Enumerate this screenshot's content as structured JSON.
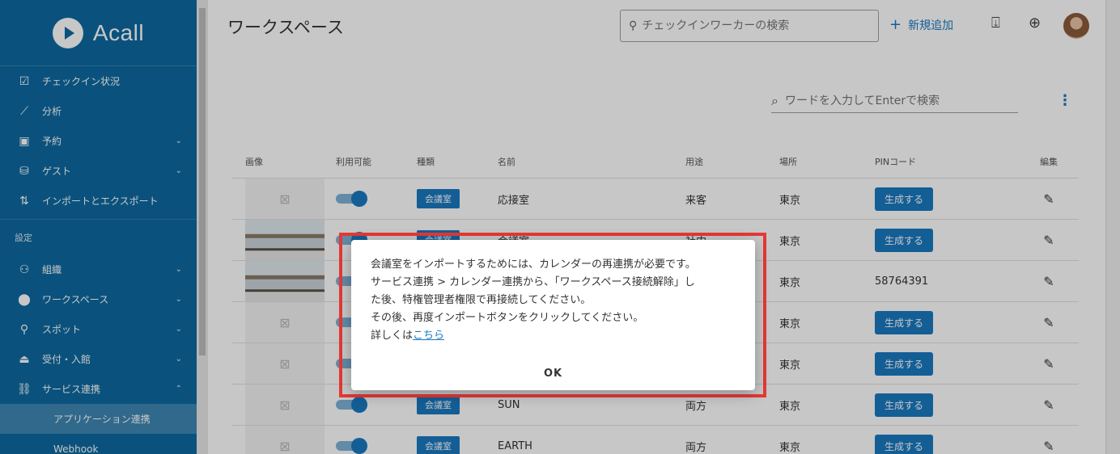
{
  "app": {
    "brand": "Acall"
  },
  "sidebar": {
    "items": [
      {
        "label": "チェックイン状況",
        "icon": "checkbox-icon",
        "glyph": "☑",
        "chevron": ""
      },
      {
        "label": "分析",
        "icon": "chart-icon",
        "glyph": "⟋",
        "chevron": ""
      },
      {
        "label": "予約",
        "icon": "calendar-icon",
        "glyph": "▣",
        "chevron": "⌄"
      },
      {
        "label": "ゲスト",
        "icon": "guest-icon",
        "glyph": "⛁",
        "chevron": "⌄"
      },
      {
        "label": "インポートとエクスポート",
        "icon": "import-export-icon",
        "glyph": "⇅",
        "chevron": ""
      }
    ],
    "section_label": "設定",
    "settings_items": [
      {
        "label": "組織",
        "icon": "people-icon",
        "glyph": "⚇",
        "chevron": "⌄"
      },
      {
        "label": "ワークスペース",
        "icon": "location-pin-icon",
        "glyph": "⬤",
        "chevron": "⌄"
      },
      {
        "label": "スポット",
        "icon": "spot-pin-icon",
        "glyph": "⚲",
        "chevron": "⌄"
      },
      {
        "label": "受付・入館",
        "icon": "reception-icon",
        "glyph": "⏏",
        "chevron": "⌄"
      },
      {
        "label": "サービス連携",
        "icon": "integration-icon",
        "glyph": "⛓",
        "chevron": "⌃"
      }
    ],
    "sub_items": [
      {
        "label": "アプリケーション連携",
        "active": true
      },
      {
        "label": "Webhook",
        "active": false
      }
    ]
  },
  "header": {
    "title": "ワークスペース",
    "search_placeholder": "チェックインワーカーの検索",
    "new_label": "新規追加"
  },
  "main": {
    "search_placeholder": "ワードを入力してEnterで検索"
  },
  "table": {
    "columns": [
      "画像",
      "利用可能",
      "種類",
      "名前",
      "用途",
      "場所",
      "PINコード",
      "編集"
    ],
    "rows": [
      {
        "image": "none",
        "type": "会議室",
        "name": "応接室",
        "use": "来客",
        "location": "東京",
        "pin": "生成する",
        "pin_is_button": true
      },
      {
        "image": "photo",
        "type": "会議室",
        "name": "会議室",
        "use": "社内",
        "location": "東京",
        "pin": "生成する",
        "pin_is_button": true
      },
      {
        "image": "photo",
        "type": "",
        "name": "",
        "use": "",
        "location": "東京",
        "pin": "58764391",
        "pin_is_button": false
      },
      {
        "image": "none",
        "type": "",
        "name": "",
        "use": "",
        "location": "東京",
        "pin": "生成する",
        "pin_is_button": true
      },
      {
        "image": "none",
        "type": "",
        "name": "",
        "use": "",
        "location": "東京",
        "pin": "生成する",
        "pin_is_button": true
      },
      {
        "image": "none",
        "type": "会議室",
        "name": "SUN",
        "use": "両方",
        "location": "東京",
        "pin": "生成する",
        "pin_is_button": true
      },
      {
        "image": "none",
        "type": "会議室",
        "name": "EARTH",
        "use": "両方",
        "location": "東京",
        "pin": "生成する",
        "pin_is_button": true
      }
    ]
  },
  "dialog": {
    "line1": "会議室をインポートするためには、カレンダーの再連携が必要です。",
    "line2": "サービス連携 > カレンダー連携から、「ワークスペース接続解除」し",
    "line3": "た後、特権管理者権限で再接続してください。",
    "line4": "その後、再度インポートボタンをクリックしてください。",
    "line5_prefix": "詳しくは",
    "link_label": "こちら",
    "ok_label": "OK"
  },
  "colors": {
    "sidebar": "#0e6aa0",
    "accent": "#1a79c0",
    "highlight": "#e53935"
  }
}
